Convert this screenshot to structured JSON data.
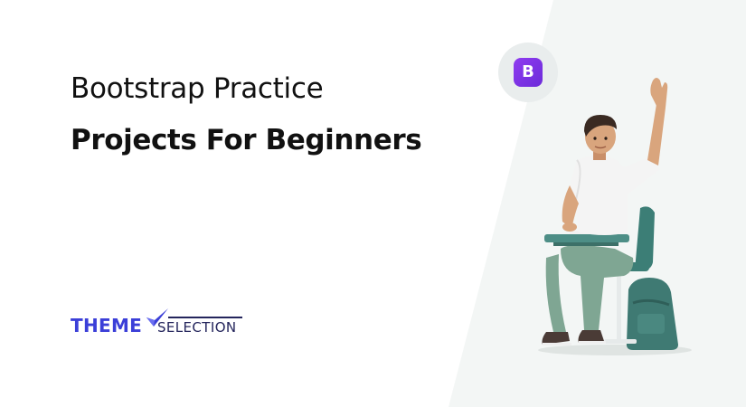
{
  "banner": {
    "title_line1": "Bootstrap Practice",
    "title_line2": "Projects For Beginners"
  },
  "logo": {
    "part1": "THEME",
    "part2": "SELECTION"
  },
  "badge": {
    "letter": "B"
  },
  "colors": {
    "background": "#ffffff",
    "right_panel": "#f3f6f5",
    "title_text": "#111111",
    "logo_primary": "#3b3fd8",
    "logo_secondary": "#24255c",
    "bootstrap_purple": "#7b33e6",
    "badge_circle": "#e9eded"
  },
  "icons": {
    "brand_badge": "bootstrap-b-icon",
    "logo_mark": "checkmark-swoosh-icon",
    "illustration": "student-raising-hand-at-desk"
  }
}
